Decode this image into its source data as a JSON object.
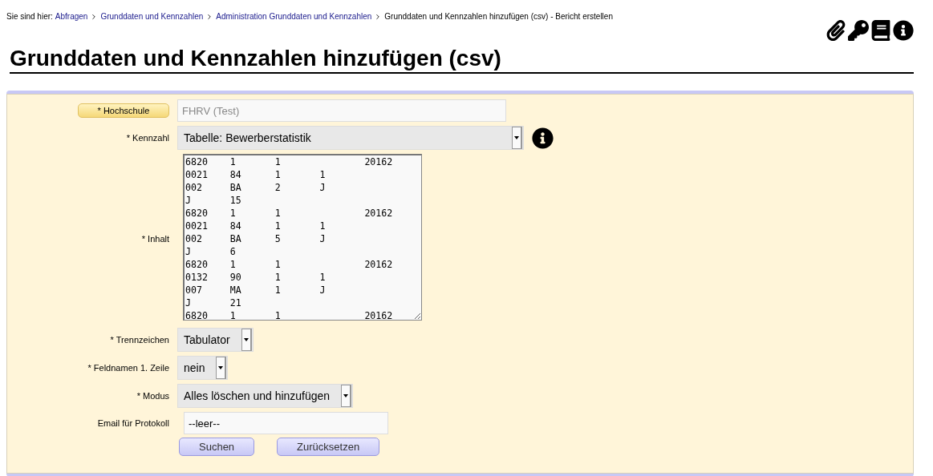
{
  "breadcrumb": {
    "prefix": "Sie sind hier:",
    "links": [
      "Abfragen",
      "Grunddaten und Kennzahlen",
      "Administration Grunddaten und Kennzahlen"
    ],
    "current": "Grunddaten und Kennzahlen hinzufügen (csv) - Bericht erstellen"
  },
  "title": "Grunddaten und Kennzahlen hinzufügen (csv)",
  "fields": [
    {
      "kind": "text",
      "label": "* Hochschule",
      "label_button": true,
      "value": "FHRV (Test)",
      "disabled": true
    },
    {
      "kind": "select-wide",
      "label": "* Kennzahl",
      "label_button": false,
      "value": "Tabelle: Bewerberstatistik",
      "info": true
    },
    {
      "kind": "textarea",
      "label": "* Inhalt",
      "label_button": false,
      "value": "6820\t1\t1\t\t20162\n0021\t84\t1\t1\n002\tBA\t2\tJ\nJ\t15\n6820\t1\t1\t\t20162\n0021\t84\t1\t1\n002\tBA\t5\tJ\nJ\t6\n6820\t1\t1\t\t20162\n0132\t90\t1\t1\n007\tMA\t1\tJ\nJ\t21\n6820\t1\t1\t\t20162"
    },
    {
      "kind": "select",
      "label": "* Trennzeichen",
      "label_button": false,
      "value": "Tabulator"
    },
    {
      "kind": "select",
      "label": "* Feldnamen 1. Zeile",
      "label_button": false,
      "value": "nein"
    },
    {
      "kind": "select",
      "label": "* Modus",
      "label_button": false,
      "value": "Alles löschen und hinzufügen"
    },
    {
      "kind": "text",
      "label": "Email für Protokoll",
      "label_button": false,
      "value": "--leer--",
      "disabled": false
    }
  ],
  "buttons": [
    "Suchen",
    "Zurücksetzen"
  ]
}
